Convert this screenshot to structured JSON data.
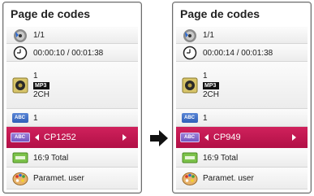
{
  "panels": [
    {
      "title": "Page de codes",
      "title_number": "1/1",
      "time": "00:00:10 / 00:01:38",
      "audio": {
        "track": "1",
        "format": "MP3",
        "channels": "2CH"
      },
      "subtitle": "1",
      "abc_label": "ABC",
      "code_page": "CP1252",
      "aspect": "16:9 Total",
      "picture_mode": "Paramet. user"
    },
    {
      "title": "Page de codes",
      "title_number": "1/1",
      "time": "00:00:14 / 00:01:38",
      "audio": {
        "track": "1",
        "format": "MP3",
        "channels": "2CH"
      },
      "subtitle": "1",
      "abc_label": "ABC",
      "code_page": "CP949",
      "aspect": "16:9 Total",
      "picture_mode": "Paramet. user"
    }
  ],
  "icons": {
    "title": "disc-icon",
    "time": "clock-icon",
    "audio": "speaker-icon",
    "subtitle": "subtitle-abc-icon",
    "code_page": "code-page-icon",
    "aspect": "aspect-ratio-icon",
    "picture_mode": "palette-icon",
    "transition": "arrow-right-icon"
  },
  "colors": {
    "selected_row": "#c0184f",
    "abc_blue": "#2f5fb8",
    "code_purple": "#7457c0"
  }
}
